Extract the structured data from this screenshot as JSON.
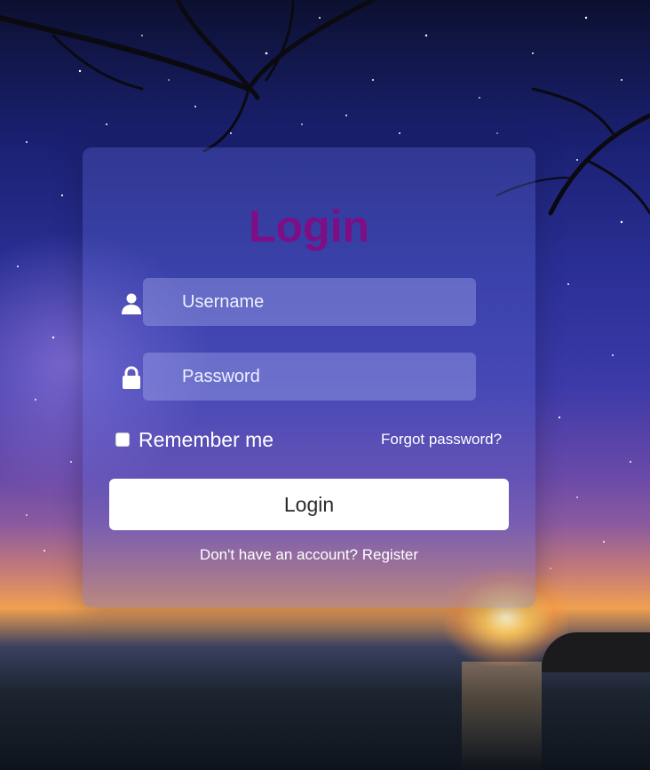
{
  "login_form": {
    "title": "Login",
    "username": {
      "placeholder": "Username",
      "value": ""
    },
    "password": {
      "placeholder": "Password",
      "value": ""
    },
    "remember_label": "Remember me",
    "remember_checked": false,
    "forgot_label": "Forgot password?",
    "submit_label": "Login",
    "register_prompt": "Don't have an account?",
    "register_link": "Register"
  },
  "colors": {
    "title": "#7e0e86",
    "button_bg": "#ffffff",
    "button_text": "#2a2a2a",
    "text": "#ffffff"
  },
  "icons": {
    "username": "user-icon",
    "password": "lock-icon"
  }
}
